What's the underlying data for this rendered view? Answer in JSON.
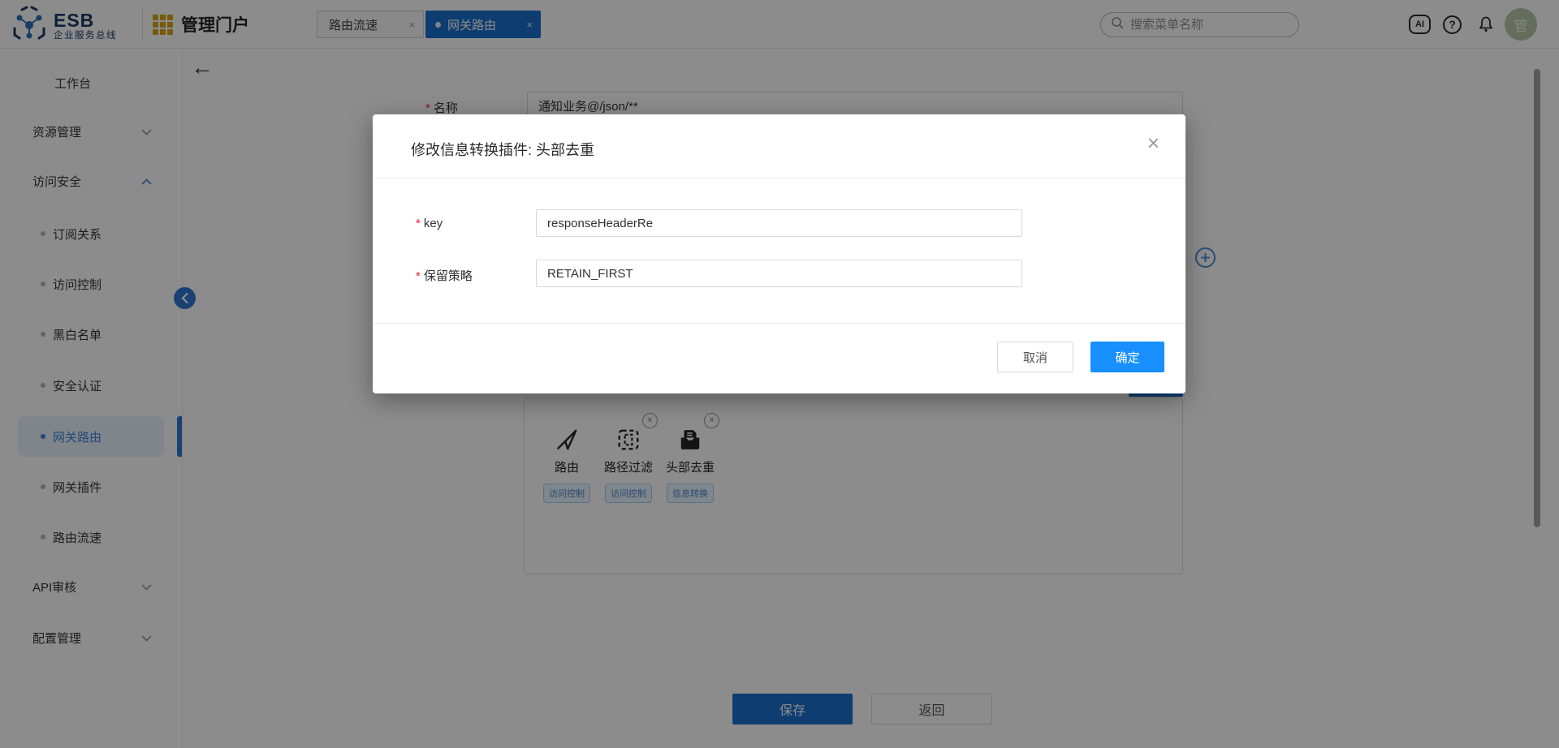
{
  "header": {
    "logo_title": "ESB",
    "logo_subtitle": "企业服务总线",
    "portal_title": "管理门户",
    "tabs": [
      {
        "label": "路由流速",
        "close": "×"
      },
      {
        "label": "网关路由",
        "close": "×"
      }
    ],
    "search_placeholder": "搜索菜单名称",
    "avatar_text": "管"
  },
  "sidebar": {
    "items": [
      {
        "label": "工作台"
      },
      {
        "label": "资源管理"
      },
      {
        "label": "访问安全"
      },
      {
        "label": "API审核"
      },
      {
        "label": "配置管理"
      }
    ],
    "submenu": [
      {
        "label": "订阅关系"
      },
      {
        "label": "访问控制"
      },
      {
        "label": "黑白名单"
      },
      {
        "label": "安全认证"
      },
      {
        "label": "网关路由"
      },
      {
        "label": "网关插件"
      },
      {
        "label": "路由流速"
      }
    ]
  },
  "content": {
    "back_arrow": "←",
    "required_mark": "*",
    "name_label": "名称",
    "name_value": "通知业务@/json/**",
    "close_badge": "×",
    "plugins": [
      {
        "name": "路由",
        "tag": "访问控制"
      },
      {
        "name": "路径过滤",
        "tag": "访问控制"
      },
      {
        "name": "头部去重",
        "tag": "信息转换"
      }
    ],
    "save_label": "保存",
    "back_label": "返回"
  },
  "modal": {
    "title": "修改信息转换插件: 头部去重",
    "close": "×",
    "required_mark": "*",
    "fields": [
      {
        "label": "key",
        "value": "responseHeaderRe"
      },
      {
        "label": "保留策略",
        "value": "RETAIN_FIRST"
      }
    ],
    "cancel_label": "取消",
    "ok_label": "确定"
  },
  "colors": {
    "primary": "#1890ff",
    "active_tab": "#1b6fce",
    "selected_menu_bg": "#e8f2fd",
    "selected_menu_text": "#3e83d9",
    "required_mark": "#f5222d",
    "tag_text": "#4a87d0",
    "tag_bg": "#e8f4ff",
    "avatar_bg": "#b9c7aa",
    "grid_icon": "#d9a514"
  }
}
